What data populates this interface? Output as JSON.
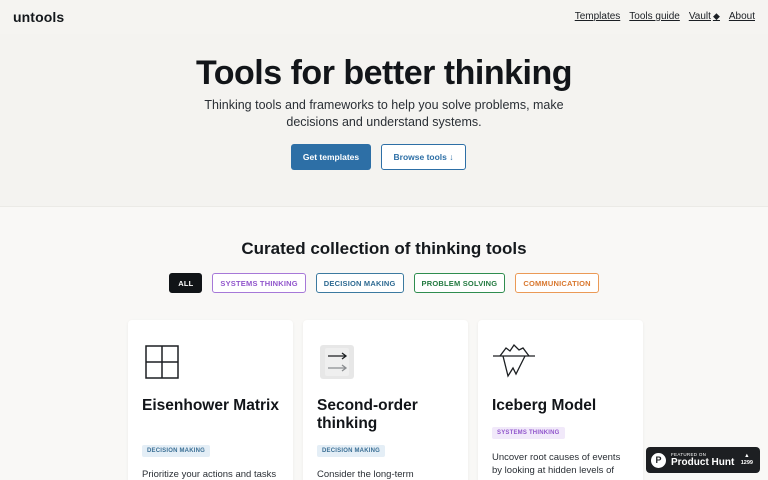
{
  "nav": {
    "logo": "untools",
    "links": [
      "Templates",
      "Tools guide",
      "Vault",
      "About"
    ]
  },
  "hero": {
    "title": "Tools for better thinking",
    "subtitle": "Thinking tools and frameworks to help you solve problems, make decisions and understand systems.",
    "primary_button": "Get templates",
    "secondary_button": "Browse tools ↓"
  },
  "collection": {
    "title": "Curated collection of thinking tools",
    "filters": [
      "ALL",
      "SYSTEMS THINKING",
      "DECISION MAKING",
      "PROBLEM SOLVING",
      "COMMUNICATION"
    ],
    "cards": [
      {
        "title": "Eisenhower Matrix",
        "tag": "DECISION MAKING",
        "description": "Prioritize your actions and tasks",
        "icon": "grid-icon"
      },
      {
        "title": "Second-order thinking",
        "tag": "DECISION MAKING",
        "description": "Consider the long-term",
        "icon": "arrows-icon"
      },
      {
        "title": "Iceberg Model",
        "tag": "SYSTEMS THINKING",
        "description": "Uncover root causes of events by looking at hidden levels of",
        "icon": "iceberg-icon"
      }
    ]
  },
  "badge": {
    "featured": "FEATURED ON",
    "name": "Product Hunt",
    "votes": "1299"
  },
  "colors": {
    "primary": "#2d6fa6",
    "systems": "#9156cc",
    "decision": "#2e6a92",
    "problem": "#237a40",
    "communication": "#d9782f"
  }
}
